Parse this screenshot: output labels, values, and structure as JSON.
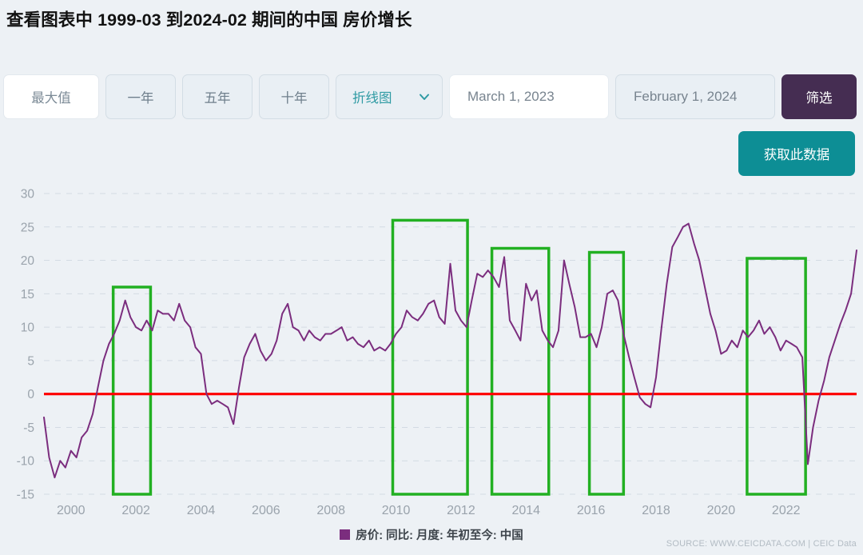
{
  "title": {
    "prefix": "查看图表中",
    "start_period": "1999-03",
    "middle": "到2024-02",
    "suffix": "期间的中国",
    "metric": "房价增长"
  },
  "toolbar": {
    "range_max_label": "最大值",
    "range_1y_label": "一年",
    "range_5y_label": "五年",
    "range_10y_label": "十年",
    "chart_type_label": "折线图",
    "chart_type_icon": "chevron-down-icon",
    "date_from": "March 1, 2023",
    "date_to": "February 1, 2024",
    "filter_label": "筛选",
    "get_data_label": "获取此数据"
  },
  "legend": {
    "series_label": "房价: 同比: 月度: 年初至今: 中国",
    "swatch_color": "#7b2d7e"
  },
  "footer": {
    "source": "SOURCE: WWW.CEICDATA.COM | CEIC Data"
  },
  "colors": {
    "background": "#edf1f5",
    "line": "#7b2d7e",
    "zero_line": "#fe0000",
    "highlight_box": "#22b022",
    "filter_button": "#452d52",
    "get_data_button": "#0d8e95",
    "accent_teal": "#2e9aa3",
    "grid": "#cfd8e0"
  },
  "chart_data": {
    "type": "line",
    "title": "",
    "xlabel": "",
    "ylabel": "",
    "ylim": [
      -15,
      30
    ],
    "xlim": [
      1999.17,
      2024.17
    ],
    "ytick_values": [
      30,
      25,
      20,
      15,
      10,
      5,
      0,
      -5,
      -10,
      -15
    ],
    "xtick_values": [
      2000,
      2002,
      2004,
      2006,
      2008,
      2010,
      2012,
      2014,
      2016,
      2018,
      2020,
      2022
    ],
    "grid": true,
    "legend_position": "bottom-center",
    "zero_reference_line": 0,
    "series": [
      {
        "name": "房价: 同比: 月度: 年初至今: 中国",
        "color": "#7b2d7e",
        "x": [
          1999.17,
          1999.33,
          1999.5,
          1999.67,
          1999.83,
          2000.0,
          2000.17,
          2000.33,
          2000.5,
          2000.67,
          2000.83,
          2001.0,
          2001.17,
          2001.33,
          2001.5,
          2001.67,
          2001.83,
          2002.0,
          2002.17,
          2002.33,
          2002.5,
          2002.67,
          2002.83,
          2003.0,
          2003.17,
          2003.33,
          2003.5,
          2003.67,
          2003.83,
          2004.0,
          2004.17,
          2004.33,
          2004.5,
          2004.67,
          2004.83,
          2005.0,
          2005.17,
          2005.33,
          2005.5,
          2005.67,
          2005.83,
          2006.0,
          2006.17,
          2006.33,
          2006.5,
          2006.67,
          2006.83,
          2007.0,
          2007.17,
          2007.33,
          2007.5,
          2007.67,
          2007.83,
          2008.0,
          2008.17,
          2008.33,
          2008.5,
          2008.67,
          2008.83,
          2009.0,
          2009.17,
          2009.33,
          2009.5,
          2009.67,
          2009.83,
          2010.0,
          2010.17,
          2010.33,
          2010.5,
          2010.67,
          2010.83,
          2011.0,
          2011.17,
          2011.33,
          2011.5,
          2011.67,
          2011.83,
          2012.0,
          2012.17,
          2012.33,
          2012.5,
          2012.67,
          2012.83,
          2013.0,
          2013.17,
          2013.33,
          2013.5,
          2013.67,
          2013.83,
          2014.0,
          2014.17,
          2014.33,
          2014.5,
          2014.67,
          2014.83,
          2015.0,
          2015.17,
          2015.33,
          2015.5,
          2015.67,
          2015.83,
          2016.0,
          2016.17,
          2016.33,
          2016.5,
          2016.67,
          2016.83,
          2017.0,
          2017.17,
          2017.33,
          2017.5,
          2017.67,
          2017.83,
          2018.0,
          2018.17,
          2018.33,
          2018.5,
          2018.67,
          2018.83,
          2019.0,
          2019.17,
          2019.33,
          2019.5,
          2019.67,
          2019.83,
          2020.0,
          2020.17,
          2020.33,
          2020.5,
          2020.67,
          2020.83,
          2021.0,
          2021.17,
          2021.33,
          2021.5,
          2021.67,
          2021.83,
          2022.0,
          2022.17,
          2022.33,
          2022.5,
          2022.67,
          2022.83,
          2023.0,
          2023.17,
          2023.33,
          2023.5,
          2023.67,
          2023.83,
          2024.0,
          2024.17
        ],
        "y": [
          -3.5,
          -9.5,
          -12.5,
          -10.0,
          -11.0,
          -8.5,
          -9.5,
          -6.5,
          -5.5,
          -3.0,
          1.0,
          5.0,
          7.5,
          9.0,
          11.0,
          14.0,
          11.5,
          10.0,
          9.5,
          11.0,
          9.5,
          12.5,
          12.0,
          12.0,
          11.0,
          13.5,
          11.0,
          10.0,
          7.0,
          6.0,
          0.0,
          -1.5,
          -1.0,
          -1.5,
          -2.0,
          -4.5,
          1.0,
          5.5,
          7.5,
          9.0,
          6.5,
          5.0,
          6.0,
          8.0,
          12.0,
          13.5,
          10.0,
          9.5,
          8.0,
          9.5,
          8.5,
          8.0,
          9.0,
          9.0,
          9.5,
          10.0,
          8.0,
          8.5,
          7.5,
          7.0,
          8.0,
          6.5,
          7.0,
          6.5,
          7.5,
          9.0,
          10.0,
          12.5,
          11.5,
          11.0,
          12.0,
          13.5,
          14.0,
          11.5,
          10.5,
          19.5,
          12.5,
          11.0,
          10.0,
          14.0,
          18.0,
          17.5,
          18.5,
          17.5,
          16.0,
          20.5,
          11.0,
          9.5,
          8.0,
          16.5,
          14.0,
          15.5,
          9.5,
          8.0,
          7.0,
          9.5,
          20.0,
          16.5,
          13.0,
          8.5,
          8.5,
          9.0,
          7.0,
          10.0,
          15.0,
          15.5,
          14.0,
          9.0,
          5.5,
          2.5,
          -0.5,
          -1.5,
          -2.0,
          2.5,
          10.0,
          16.5,
          22.0,
          23.5,
          25.0,
          25.5,
          22.5,
          20.0,
          16.0,
          12.0,
          9.5,
          6.0,
          6.5,
          8.0,
          7.0,
          9.5,
          8.5,
          9.5,
          11.0,
          9.0,
          10.0,
          8.5,
          6.5,
          8.0,
          7.5,
          7.0,
          5.5,
          -10.5,
          -5.0,
          -1.0,
          2.0,
          5.5,
          8.0,
          10.5,
          12.5,
          15.0,
          21.5
        ]
      }
    ],
    "highlight_boxes": [
      {
        "x_start": 2001.3,
        "x_end": 2002.45,
        "y_top": 16.0,
        "y_bottom": -15.0
      },
      {
        "x_start": 2009.9,
        "x_end": 2012.2,
        "y_top": 26.0,
        "y_bottom": -15.0
      },
      {
        "x_start": 2012.95,
        "x_end": 2014.7,
        "y_top": 21.8,
        "y_bottom": -15.0
      },
      {
        "x_start": 2015.95,
        "x_end": 2017.0,
        "y_top": 21.2,
        "y_bottom": -15.0
      },
      {
        "x_start": 2020.8,
        "x_end": 2022.6,
        "y_top": 20.3,
        "y_bottom": -15.0
      }
    ]
  }
}
